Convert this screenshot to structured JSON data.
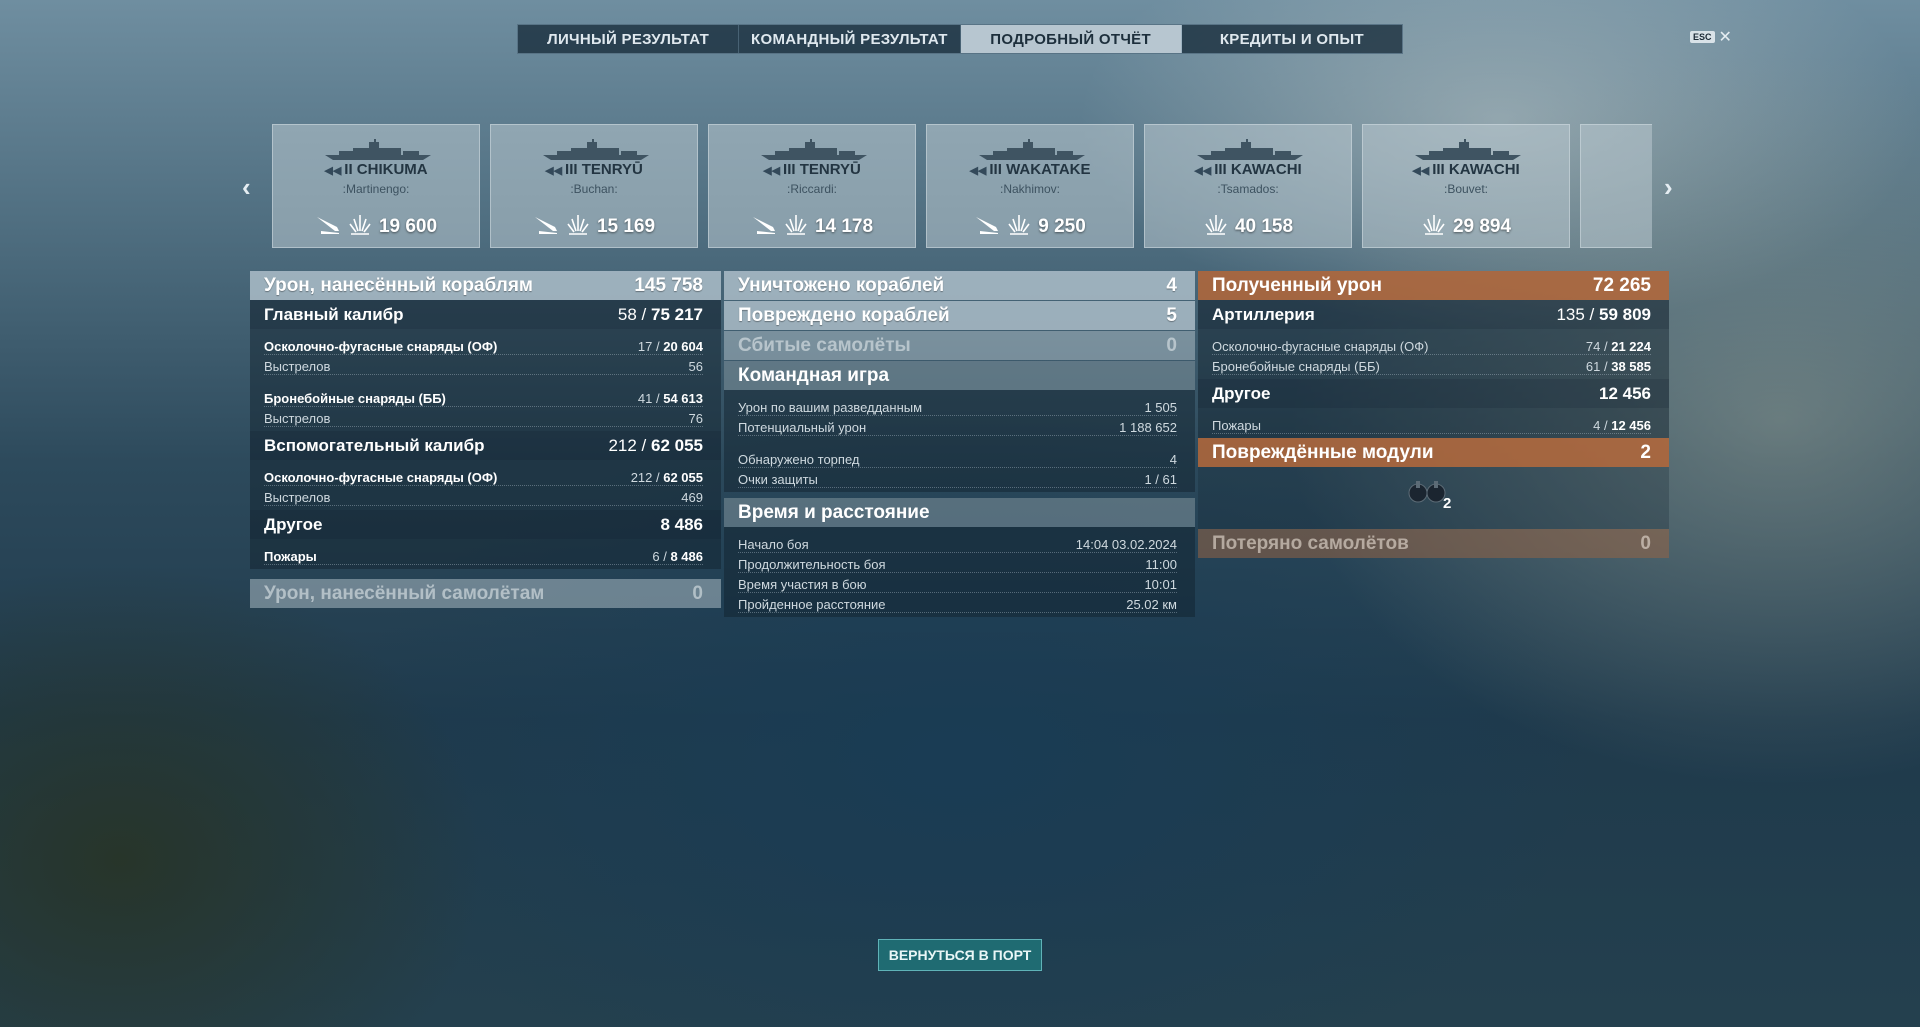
{
  "tabs": [
    {
      "label": "ЛИЧНЫЙ РЕЗУЛЬТАТ",
      "active": false
    },
    {
      "label": "КОМАНДНЫЙ РЕЗУЛЬТАТ",
      "active": false
    },
    {
      "label": "ПОДРОБНЫЙ ОТЧЁТ",
      "active": true
    },
    {
      "label": "КРЕДИТЫ И ОПЫТ",
      "active": false
    }
  ],
  "esc": {
    "key": "ESC",
    "close": "✕"
  },
  "carousel": {
    "prev": "‹",
    "next": "›",
    "cards": [
      {
        "tier": "II",
        "name": "CHIKUMA",
        "player": ":Martinengo:",
        "damage": "19 600",
        "has_plane_icon": true
      },
      {
        "tier": "III",
        "name": "TENRYŪ",
        "player": ":Buchan:",
        "damage": "15 169",
        "has_plane_icon": true
      },
      {
        "tier": "III",
        "name": "TENRYŪ",
        "player": ":Riccardi:",
        "damage": "14 178",
        "has_plane_icon": true
      },
      {
        "tier": "III",
        "name": "WAKATAKE",
        "player": ":Nakhimov:",
        "damage": "9 250",
        "has_plane_icon": true
      },
      {
        "tier": "III",
        "name": "KAWACHI",
        "player": ":Tsamados:",
        "damage": "40 158",
        "has_plane_icon": false
      },
      {
        "tier": "III",
        "name": "KAWACHI",
        "player": ":Bouvet:",
        "damage": "29 894",
        "has_plane_icon": false
      }
    ]
  },
  "col1": {
    "total": {
      "label": "Урон, нанесённый кораблям",
      "value": "145 758"
    },
    "main": {
      "label": "Главный калибр",
      "hits": "58",
      "value": "75 217"
    },
    "main_rows": [
      {
        "label": "Осколочно-фугасные снаряды (ОФ)",
        "hits": "17",
        "value": "20 604",
        "bold": true
      },
      {
        "label": "Выстрелов",
        "plain": "56",
        "bold": false
      },
      {
        "label": "Бронебойные снаряды (ББ)",
        "hits": "41",
        "value": "54 613",
        "bold": true
      },
      {
        "label": "Выстрелов",
        "plain": "76",
        "bold": false
      }
    ],
    "secondary": {
      "label": "Вспомогательный калибр",
      "hits": "212",
      "value": "62 055"
    },
    "secondary_rows": [
      {
        "label": "Осколочно-фугасные снаряды (ОФ)",
        "hits": "212",
        "value": "62 055",
        "bold": true
      },
      {
        "label": "Выстрелов",
        "plain": "469",
        "bold": false
      }
    ],
    "other": {
      "label": "Другое",
      "value": "8 486"
    },
    "other_rows": [
      {
        "label": "Пожары",
        "hits": "6",
        "value": "8 486",
        "bold": true
      }
    ],
    "planes": {
      "label": "Урон, нанесённый самолётам",
      "value": "0"
    }
  },
  "col2": {
    "destroyed": {
      "label": "Уничтожено кораблей",
      "value": "4"
    },
    "damaged": {
      "label": "Повреждено кораблей",
      "value": "5"
    },
    "planes_shot": {
      "label": "Сбитые самолёты",
      "value": "0"
    },
    "team": {
      "label": "Командная игра"
    },
    "team_rows": [
      {
        "label": "Урон по вашим разведданным",
        "plain": "1 505"
      },
      {
        "label": "Потенциальный урон",
        "plain": "1 188 652"
      },
      {
        "label": "Обнаружено торпед",
        "plain": "4"
      },
      {
        "label": "Очки защиты",
        "plain": "1 / 61"
      }
    ],
    "time": {
      "label": "Время и расстояние"
    },
    "time_rows": [
      {
        "label": "Начало боя",
        "plain": "14:04  03.02.2024"
      },
      {
        "label": "Продолжительность боя",
        "plain": "11:00"
      },
      {
        "label": "Время участия в бою",
        "plain": "10:01"
      },
      {
        "label": "Пройденное расстояние",
        "plain": "25.02 км"
      }
    ]
  },
  "col3": {
    "received": {
      "label": "Полученный урон",
      "value": "72 265"
    },
    "artillery": {
      "label": "Артиллерия",
      "hits": "135",
      "value": "59 809"
    },
    "artillery_rows": [
      {
        "label": "Осколочно-фугасные снаряды (ОФ)",
        "hits": "74",
        "value": "21 224"
      },
      {
        "label": "Бронебойные снаряды (ББ)",
        "hits": "61",
        "value": "38 585"
      }
    ],
    "other": {
      "label": "Другое",
      "value": "12 456"
    },
    "other_rows": [
      {
        "label": "Пожары",
        "hits": "4",
        "value": "12 456"
      }
    ],
    "modules": {
      "label": "Повреждённые модули",
      "value": "2",
      "icon_count": "2"
    },
    "planes_lost": {
      "label": "Потеряно самолётов",
      "value": "0"
    }
  },
  "port_button": "ВЕРНУТЬСЯ В ПОРТ",
  "colors": {
    "accent_orange": "#b0663a",
    "header_light": "#becdd7",
    "button_teal": "#1f6b72"
  }
}
